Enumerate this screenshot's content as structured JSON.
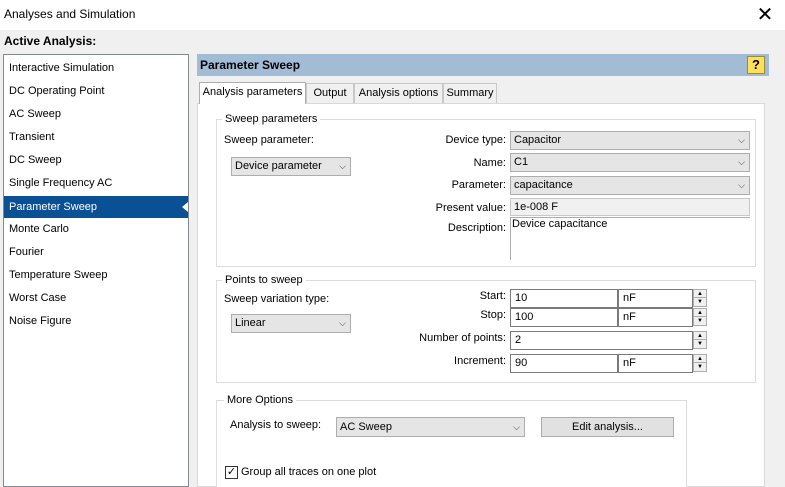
{
  "window": {
    "title": "Analyses and Simulation",
    "close_glyph": "✕"
  },
  "active_analysis_label": "Active Analysis:",
  "analyses": [
    {
      "label": "Interactive Simulation"
    },
    {
      "label": "DC Operating Point"
    },
    {
      "label": "AC Sweep"
    },
    {
      "label": "Transient"
    },
    {
      "label": "DC Sweep"
    },
    {
      "label": "Single Frequency AC"
    },
    {
      "label": "Parameter Sweep",
      "selected": true
    },
    {
      "label": "Monte Carlo"
    },
    {
      "label": "Fourier"
    },
    {
      "label": "Temperature Sweep"
    },
    {
      "label": "Worst Case"
    },
    {
      "label": "Noise Figure"
    }
  ],
  "panel": {
    "title": "Parameter Sweep",
    "help_glyph": "?"
  },
  "tabs": [
    {
      "label": "Analysis parameters",
      "active": true
    },
    {
      "label": "Output"
    },
    {
      "label": "Analysis options"
    },
    {
      "label": "Summary"
    }
  ],
  "sweep_parameters": {
    "group_title": "Sweep parameters",
    "sweep_parameter_label": "Sweep parameter:",
    "sweep_parameter_value": "Device parameter",
    "device_type_label": "Device type:",
    "device_type_value": "Capacitor",
    "name_label": "Name:",
    "name_value": "C1",
    "parameter_label": "Parameter:",
    "parameter_value": "capacitance",
    "present_value_label": "Present value:",
    "present_value": "1e-008 F",
    "description_label": "Description:",
    "description_value": "Device capacitance"
  },
  "points_to_sweep": {
    "group_title": "Points to sweep",
    "variation_type_label": "Sweep variation type:",
    "variation_type_value": "Linear",
    "start_label": "Start:",
    "start_value": "10",
    "start_unit": "nF",
    "stop_label": "Stop:",
    "stop_value": "100",
    "stop_unit": "nF",
    "num_points_label": "Number of points:",
    "num_points_value": "2",
    "increment_label": "Increment:",
    "increment_value": "90",
    "increment_unit": "nF"
  },
  "more_options": {
    "group_title": "More Options",
    "analysis_to_sweep_label": "Analysis to sweep:",
    "analysis_to_sweep_value": "AC Sweep",
    "edit_button_label": "Edit analysis...",
    "group_traces_label": "Group all traces on one plot",
    "group_traces_checked": true,
    "check_glyph": "✓"
  },
  "icons": {
    "dropdown": "chevron-down-icon",
    "spin_up": "▲",
    "spin_down": "▼",
    "chevron": "⌵"
  },
  "colors": {
    "selection": "#0a5094",
    "header_bar": "#a3bcd6",
    "help_button": "#ffe05a"
  }
}
